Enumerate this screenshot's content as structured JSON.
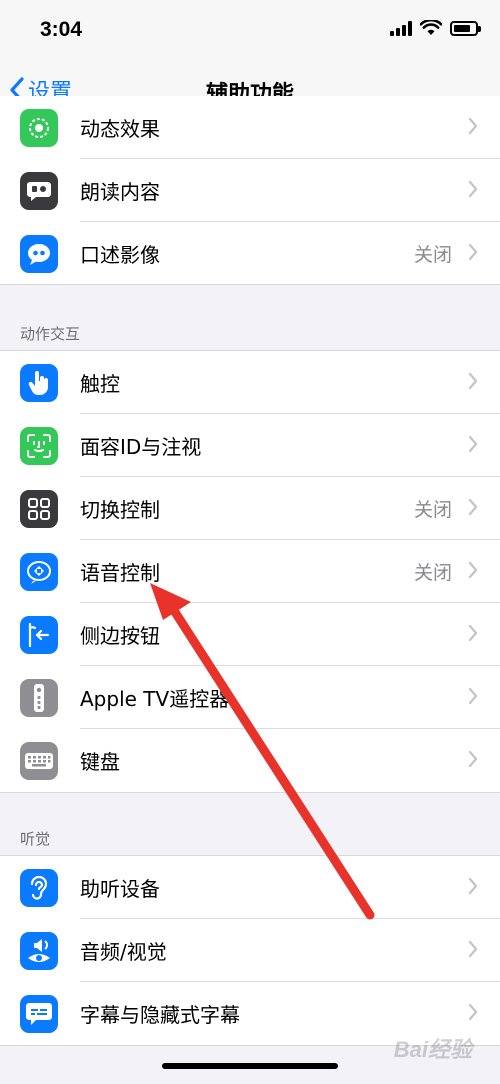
{
  "status": {
    "time": "3:04"
  },
  "nav": {
    "back_label": "设置",
    "title": "辅助功能"
  },
  "sections": {
    "interaction_header": "动作交互",
    "hearing_header": "听觉"
  },
  "vision": {
    "items": [
      {
        "label": "动态效果",
        "value": ""
      },
      {
        "label": "朗读内容",
        "value": ""
      },
      {
        "label": "口述影像",
        "value": "关闭"
      }
    ]
  },
  "interaction": {
    "items": [
      {
        "label": "触控",
        "value": ""
      },
      {
        "label": "面容ID与注视",
        "value": ""
      },
      {
        "label": "切换控制",
        "value": "关闭"
      },
      {
        "label": "语音控制",
        "value": "关闭"
      },
      {
        "label": "侧边按钮",
        "value": ""
      },
      {
        "label": "Apple TV遥控器",
        "value": ""
      },
      {
        "label": "键盘",
        "value": ""
      }
    ]
  },
  "hearing": {
    "items": [
      {
        "label": "助听设备",
        "value": ""
      },
      {
        "label": "音频/视觉",
        "value": ""
      },
      {
        "label": "字幕与隐藏式字幕",
        "value": ""
      }
    ]
  },
  "watermark": {
    "text": "Bai经验"
  },
  "colors": {
    "accent": "#0a7aff",
    "faceid_green": "#34c759",
    "dark_gray": "#3a3a3c",
    "arrow_red": "#e8332a"
  }
}
